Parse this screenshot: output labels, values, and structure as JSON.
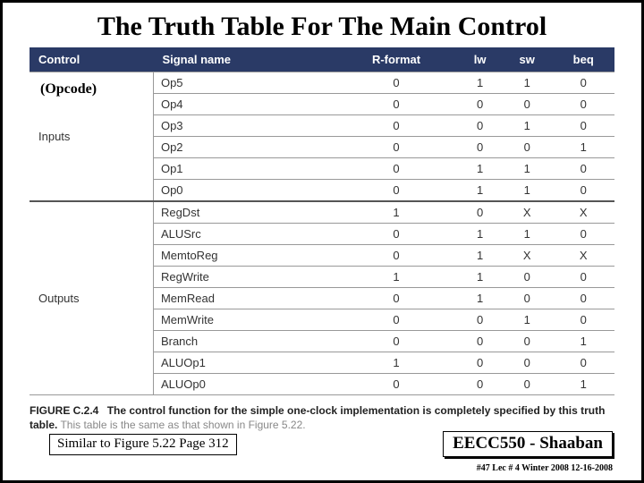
{
  "title": "The Truth Table For The Main Control",
  "opcode_note": "(Opcode)",
  "headers": {
    "c0": "Control",
    "c1": "Signal name",
    "c2": "R-format",
    "c3": "lw",
    "c4": "sw",
    "c5": "beq"
  },
  "groups": {
    "inputs": "Inputs",
    "outputs": "Outputs"
  },
  "rows": [
    {
      "sig": "Op5",
      "v": [
        "0",
        "1",
        "1",
        "0"
      ]
    },
    {
      "sig": "Op4",
      "v": [
        "0",
        "0",
        "0",
        "0"
      ]
    },
    {
      "sig": "Op3",
      "v": [
        "0",
        "0",
        "1",
        "0"
      ]
    },
    {
      "sig": "Op2",
      "v": [
        "0",
        "0",
        "0",
        "1"
      ]
    },
    {
      "sig": "Op1",
      "v": [
        "0",
        "1",
        "1",
        "0"
      ]
    },
    {
      "sig": "Op0",
      "v": [
        "0",
        "1",
        "1",
        "0"
      ]
    },
    {
      "sig": "RegDst",
      "v": [
        "1",
        "0",
        "X",
        "X"
      ]
    },
    {
      "sig": "ALUSrc",
      "v": [
        "0",
        "1",
        "1",
        "0"
      ]
    },
    {
      "sig": "MemtoReg",
      "v": [
        "0",
        "1",
        "X",
        "X"
      ]
    },
    {
      "sig": "RegWrite",
      "v": [
        "1",
        "1",
        "0",
        "0"
      ]
    },
    {
      "sig": "MemRead",
      "v": [
        "0",
        "1",
        "0",
        "0"
      ]
    },
    {
      "sig": "MemWrite",
      "v": [
        "0",
        "0",
        "1",
        "0"
      ]
    },
    {
      "sig": "Branch",
      "v": [
        "0",
        "0",
        "0",
        "1"
      ]
    },
    {
      "sig": "ALUOp1",
      "v": [
        "1",
        "0",
        "0",
        "0"
      ]
    },
    {
      "sig": "ALUOp0",
      "v": [
        "0",
        "0",
        "0",
        "1"
      ]
    }
  ],
  "caption": {
    "label": "FIGURE C.2.4",
    "bold_text": "The control function for the simple one-clock implementation is completely specified by this truth table.",
    "rest": " This table is the same as that shown in Figure 5.22."
  },
  "footer_left": "Similar to Figure 5.22 Page 312",
  "footer_right": "EECC550 - Shaaban",
  "footer_meta": "#47   Lec # 4   Winter 2008   12-16-2008"
}
